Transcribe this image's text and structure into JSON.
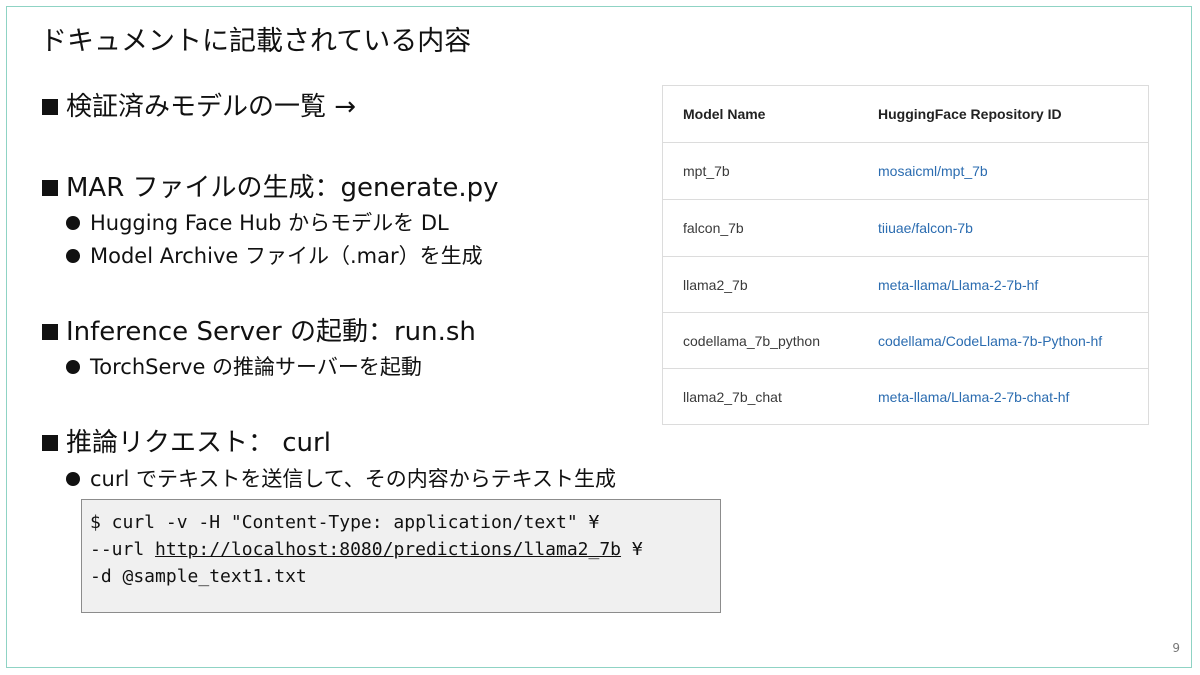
{
  "slide": {
    "title": "ドキュメントに記載されている内容",
    "page_number": "9"
  },
  "sections": [
    {
      "heading": "検証済みモデルの一覧 →",
      "bullets": []
    },
    {
      "heading": "MAR ファイルの生成：generate.py",
      "bullets": [
        "Hugging Face Hub からモデルを DL",
        "Model Archive ファイル（.mar）を生成"
      ]
    },
    {
      "heading": "Inference Server の起動：run.sh",
      "bullets": [
        "TorchServe の推論サーバーを起動"
      ]
    },
    {
      "heading": "推論リクエスト： curl",
      "bullets": [
        "curl でテキストを送信して、その内容からテキスト生成"
      ]
    }
  ],
  "code": {
    "line1": "$ curl -v -H \"Content-Type: application/text\" ¥",
    "line2_prefix": "--url ",
    "line2_link": "http://localhost:8080/predictions/llama2_7b",
    "line2_suffix": " ¥",
    "line3": "-d @sample_text1.txt"
  },
  "model_table": {
    "headers": [
      "Model Name",
      "HuggingFace Repository ID"
    ],
    "rows": [
      [
        "mpt_7b",
        "mosaicml/mpt_7b"
      ],
      [
        "falcon_7b",
        "tiiuae/falcon-7b"
      ],
      [
        "llama2_7b",
        "meta-llama/Llama-2-7b-hf"
      ],
      [
        "codellama_7b_python",
        "codellama/CodeLlama-7b-Python-hf"
      ],
      [
        "llama2_7b_chat",
        "meta-llama/Llama-2-7b-chat-hf"
      ]
    ]
  },
  "colors": {
    "frame_border": "#8fd3c4",
    "link_blue": "#2b6cb0",
    "code_bg": "#f0f0f0"
  }
}
